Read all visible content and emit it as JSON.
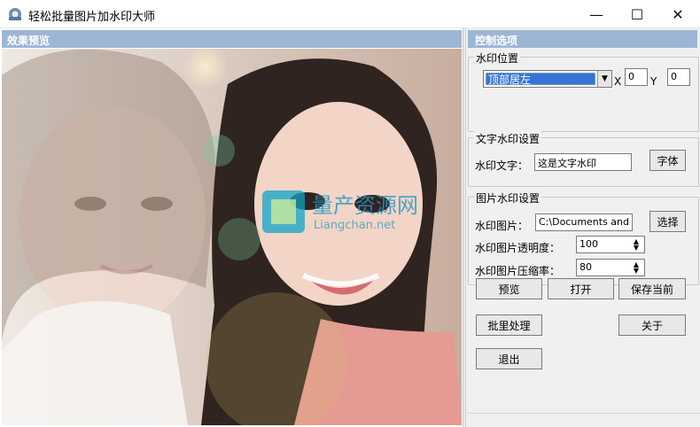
{
  "window": {
    "title": "轻松批量图片加水印大师",
    "controls": {
      "minimize": "—",
      "maximize": "☐",
      "close": "✕"
    }
  },
  "preview": {
    "header": "效果预览",
    "watermark_logo": {
      "text_main": "量产资源网",
      "text_sub": "Liangchan.net"
    }
  },
  "control_panel": {
    "header": "控制选项",
    "watermark_position": {
      "title": "水印位置",
      "selected": "顶部居左",
      "x_label": "X",
      "x_value": "0",
      "y_label": "Y",
      "y_value": "0"
    },
    "text_watermark": {
      "title": "文字水印设置",
      "text_label": "水印文字：",
      "text_value": "这是文字水印",
      "font_button": "字体"
    },
    "image_watermark": {
      "title": "图片水印设置",
      "image_label": "水印图片：",
      "image_path": "C:\\Documents and Se",
      "select_button": "选择",
      "opacity_label": "水印图片透明度：",
      "opacity_value": "100",
      "compression_label": "水印图片压缩率：",
      "compression_value": "80"
    },
    "actions": {
      "preview": "预览",
      "open": "打开",
      "save_current": "保存当前",
      "batch": "批里处理",
      "about": "关于",
      "exit": "退出"
    }
  },
  "colors": {
    "header_bg": "#9db6d6",
    "selection_bg": "#3575d6",
    "panel_bg": "#f0f0f0"
  }
}
